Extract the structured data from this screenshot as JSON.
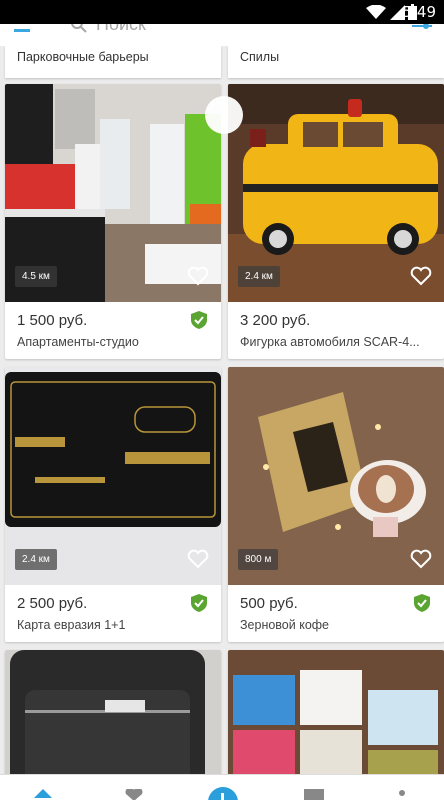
{
  "status_bar": {
    "time": "5:49"
  },
  "search": {
    "placeholder": "Поиск"
  },
  "top_cards": [
    {
      "label": "Парковочные барьеры"
    },
    {
      "label": "Спилы"
    }
  ],
  "listings": [
    {
      "price": "1 500 руб.",
      "title": "Апартаменты-студио",
      "distance": "4.5 км",
      "verified": true
    },
    {
      "price": "3 200 руб.",
      "title": "Фигурка автомобиля SCAR-4...",
      "distance": "2.4 км",
      "verified": false
    },
    {
      "price": "2 500 руб.",
      "title": "Карта евразия 1+1",
      "distance": "2.4 км",
      "verified": true
    },
    {
      "price": "500 руб.",
      "title": "Зерновой кофе",
      "distance": "800 м",
      "verified": true
    }
  ],
  "colors": {
    "accent": "#2a9fdc",
    "verified": "#5aa532"
  },
  "icons": [
    "menu-icon",
    "search-icon",
    "filter-icon",
    "heart-icon",
    "shield-check-icon",
    "home-icon",
    "add-icon",
    "mail-icon",
    "more-icon"
  ]
}
